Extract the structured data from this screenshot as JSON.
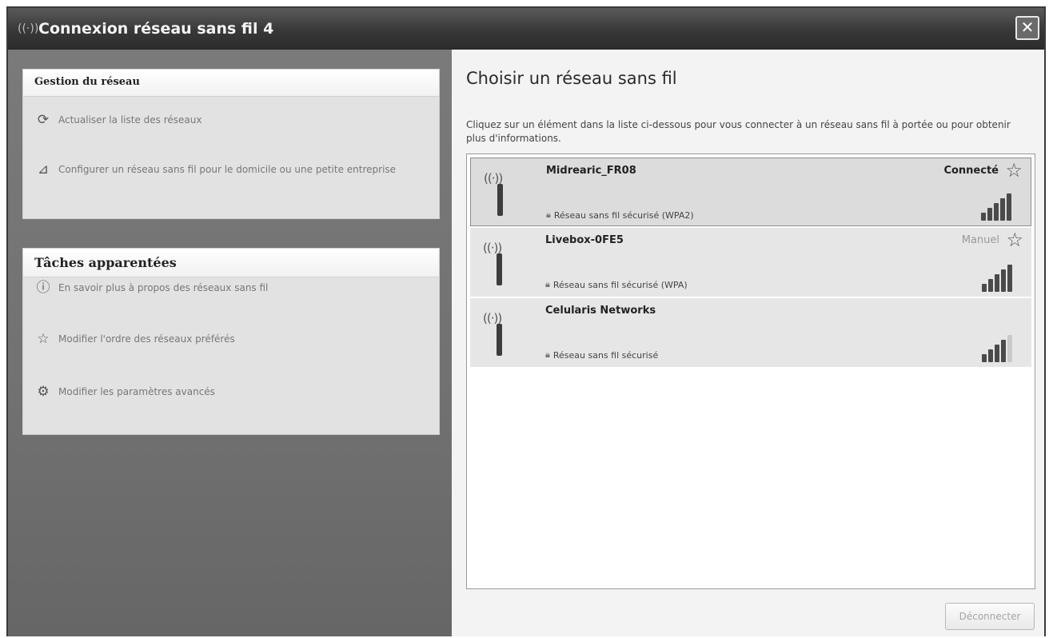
{
  "window": {
    "title": "Connexion réseau sans fil 4",
    "close_glyph": "✕"
  },
  "sidebar": {
    "network_tasks": {
      "header": "Gestion du réseau",
      "items": [
        {
          "label": "Actualiser la liste des réseaux",
          "icon": "refresh-icon"
        },
        {
          "label": "Configurer un réseau sans fil pour le domicile ou une petite entreprise",
          "icon": "wireless-setup-icon"
        }
      ]
    },
    "related_tasks": {
      "header": "Tâches apparentées",
      "items": [
        {
          "label": "En savoir plus à propos des réseaux sans fil",
          "icon": "info-icon"
        },
        {
          "label": "Modifier l'ordre des réseaux préférés",
          "icon": "star-icon"
        },
        {
          "label": "Modifier les paramètres avancés",
          "icon": "settings-icon"
        }
      ]
    }
  },
  "main": {
    "title": "Choisir un réseau sans fil",
    "description": "Cliquez sur un élément dans la liste ci-dessous pour vous connecter à un réseau sans fil à portée ou pour obtenir plus d'informations.",
    "networks": [
      {
        "name": "Midrearic_FR08",
        "status": "Connecté",
        "security": "Réseau sans fil sécurisé (WPA2)",
        "signal_bars": 5,
        "selected": true
      },
      {
        "name": "Livebox-0FE5",
        "status": "Manuel",
        "security": "Réseau sans fil sécurisé (WPA)",
        "signal_bars": 5,
        "selected": false
      },
      {
        "name": "Celularis Networks",
        "status": "",
        "security": "Réseau sans fil sécurisé",
        "signal_bars": 4,
        "selected": false
      }
    ],
    "connect_button": "Déconnecter"
  }
}
